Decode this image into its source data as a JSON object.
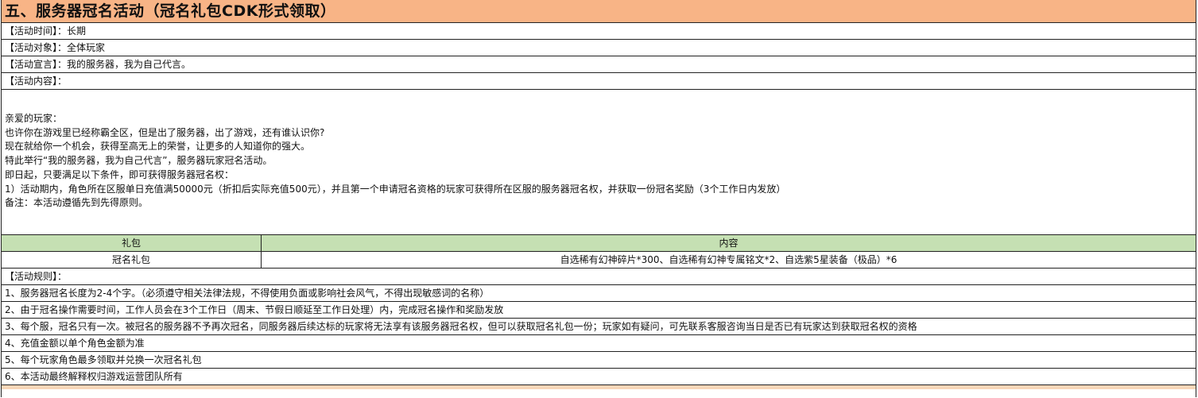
{
  "title": "五、服务器冠名活动（冠名礼包CDK形式领取）",
  "info": {
    "time": "【活动时间】：长期",
    "target": "【活动对象】：全体玩家",
    "slogan": "【活动宣言】：我的服务器，我为自己代言。",
    "content_label": "【活动内容】："
  },
  "content_lines": [
    "亲爱的玩家：",
    "也许你在游戏里已经称霸全区，但是出了服务器，出了游戏，还有谁认识你?",
    "现在就给你一个机会，获得至高无上的荣誉，让更多的人知道你的强大。",
    "特此举行“我的服务器，我为自己代言”，服务器玩家冠名活动。",
    "即日起，只要满足以下条件，即可获得服务器冠名权：",
    "1）活动期内，角色所在区服单日充值满50000元（折扣后实际充值500元），并且第一个申请冠名资格的玩家可获得所在区服的服务器冠名权，并获取一份冠名奖励（3个工作日内发放）",
    "备注：本活动遵循先到先得原则。"
  ],
  "reward_table": {
    "headers": [
      "礼包",
      "内容"
    ],
    "rows": [
      [
        "冠名礼包",
        "自选稀有幻神碎片*300、自选稀有幻神专属铭文*2、自选紫5星装备（极品）*6"
      ]
    ]
  },
  "rules_label": "【活动规则】：",
  "rules": [
    "1、服务器冠名长度为2-4个字。（必须遵守相关法律法规，不得使用负面或影响社会风气，不得出现敏感词的名称）",
    "2、由于冠名操作需要时间，工作人员会在3个工作日（周末、节假日顺延至工作日处理）内，完成冠名操作和奖励发放",
    "3、每个服，冠名只有一次。被冠名的服务器不予再次冠名，同服务器后续达标的玩家将无法享有该服务器冠名权，但可以获取冠名礼包一份；玩家如有疑问，可先联系客服咨询当日是否已有玩家达到获取冠名权的资格",
    "4、充值金额以单个角色金额为准",
    "5、每个玩家角色最多领取并兑换一次冠名礼包",
    "6、本活动最终解释权归游戏运营团队所有"
  ],
  "colors": {
    "title_bg": "#f8b486",
    "table_header_bg": "#c5e0b3",
    "grid_line": "#222222"
  }
}
